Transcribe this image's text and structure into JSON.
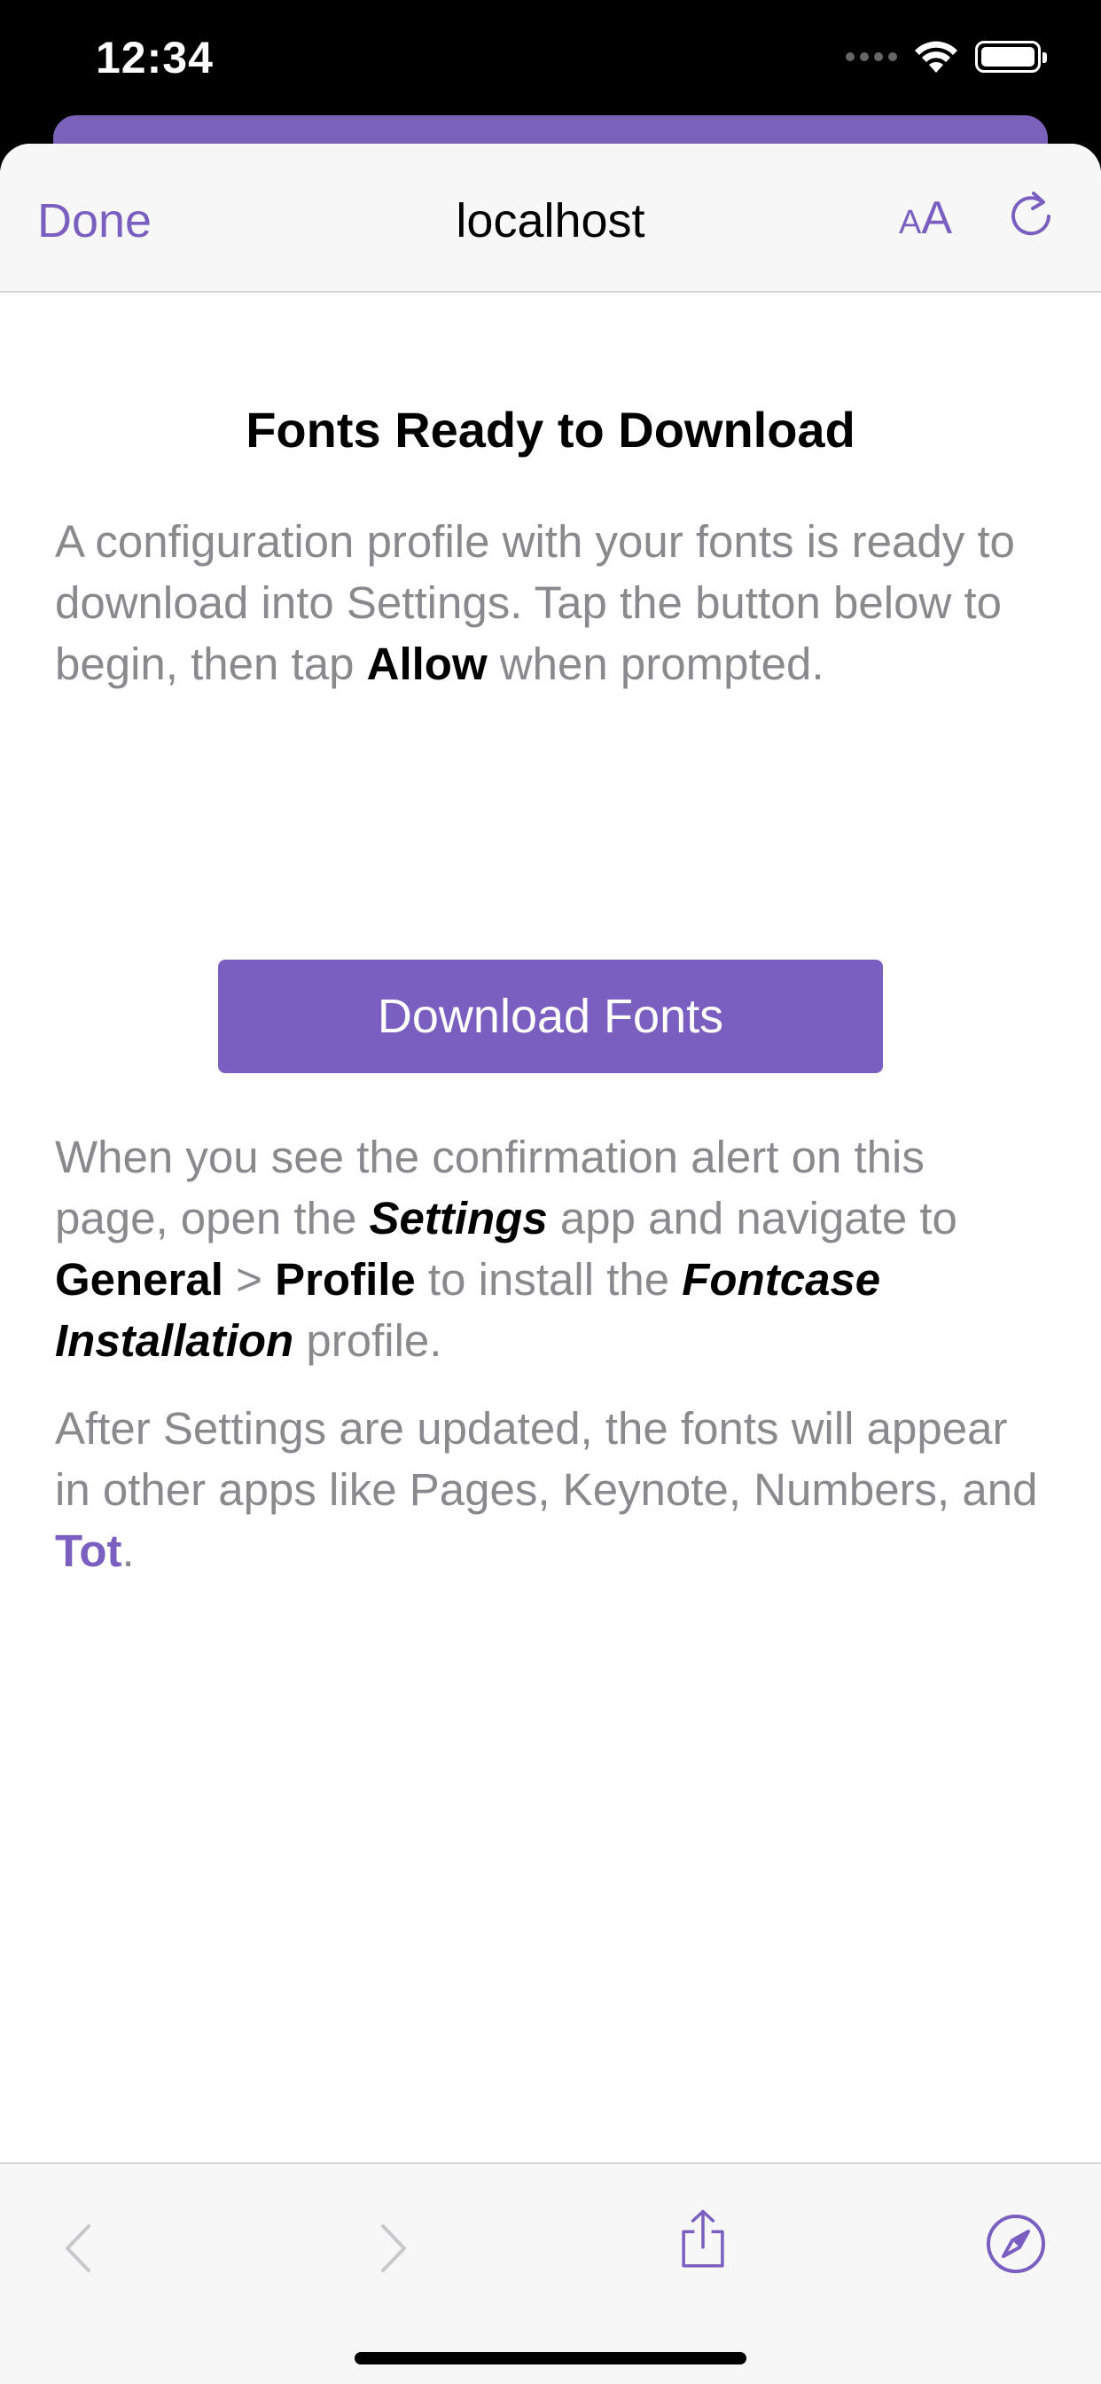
{
  "status_bar": {
    "time": "12:34"
  },
  "nav": {
    "done_label": "Done",
    "title": "localhost",
    "text_size_small": "A",
    "text_size_large": "A",
    "accent_color": "#7a5fc0"
  },
  "content": {
    "heading": "Fonts Ready to Download",
    "p1": {
      "text_before": "A configuration profile with your fonts is ready to download into Settings. Tap the button below to begin, then tap ",
      "bold": "Allow",
      "text_after": " when prompted."
    },
    "button_label": "Download Fonts",
    "p2": {
      "t1": "When you see the confirmation alert on this page, open the ",
      "settings": "Settings",
      "t2": " app and navigate to ",
      "general": "General",
      "t3": " > ",
      "profile": "Profile",
      "t4": " to install the ",
      "fontcase": "Fontcase Installation",
      "t5": " profile."
    },
    "p3": {
      "t1": "After Settings are updated, the fonts will appear in other apps like Pages, Keynote, Numbers, and ",
      "tot": "Tot",
      "t2": "."
    }
  },
  "toolbar": {
    "icons": [
      "back-chevron-icon",
      "forward-chevron-icon",
      "share-icon",
      "safari-compass-icon"
    ]
  }
}
